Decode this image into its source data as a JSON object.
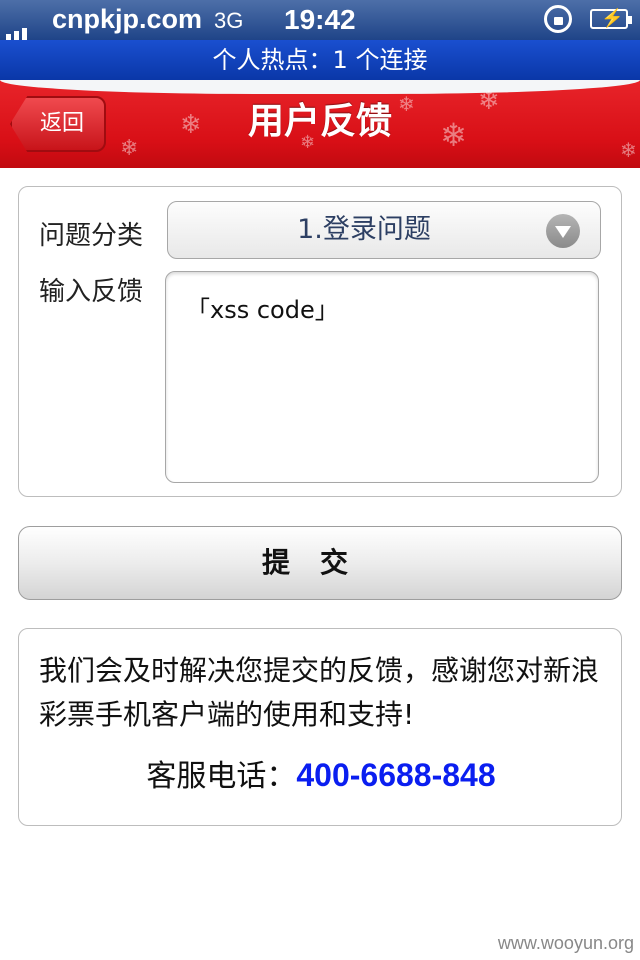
{
  "status_bar": {
    "carrier": "cnpkjp.com",
    "network": "3G",
    "time": "19:42"
  },
  "hotspot_bar": {
    "text": "个人热点：1 个连接"
  },
  "nav": {
    "back_label": "返回",
    "title": "用户反馈"
  },
  "form": {
    "category_label": "问题分类",
    "category_value": "1.登录问题",
    "feedback_label": "输入反馈",
    "feedback_value": "「xss code」"
  },
  "submit_label": "提交",
  "info": {
    "message": "我们会及时解决您提交的反馈，感谢您对新浪彩票手机客户端的使用和支持!",
    "hotline_label": "客服电话：",
    "hotline_number": "400-6688-848"
  },
  "watermark": "www.wooyun.org",
  "colors": {
    "nav_red": "#d80f16",
    "hotspot_blue": "#0a37a8",
    "hotline_blue": "#0a1ef0"
  }
}
